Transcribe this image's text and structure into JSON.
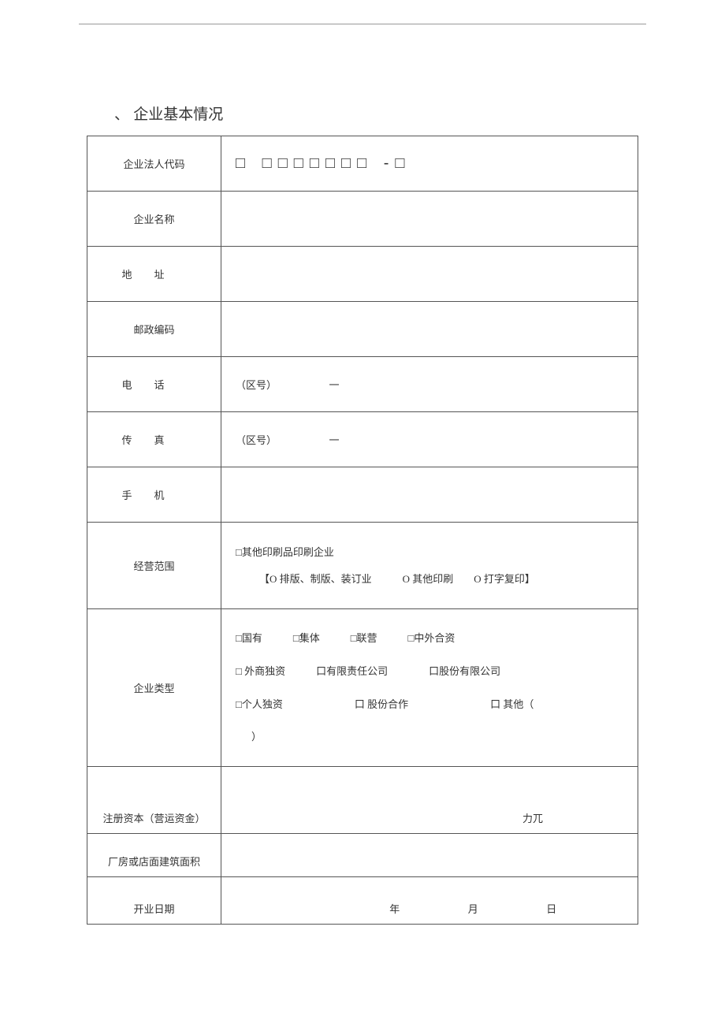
{
  "title": "、 企业基本情况",
  "rows": {
    "legal_code": {
      "label": "企业法人代码",
      "boxes": "□ □□□□□□□ -□"
    },
    "name": {
      "label": "企业名称"
    },
    "address": {
      "label_a": "地",
      "label_b": "址"
    },
    "postal": {
      "label": "邮政编码"
    },
    "phone": {
      "label_a": "电",
      "label_b": "话",
      "prefix": "（区号）",
      "dash": "一"
    },
    "fax": {
      "label_a": "传",
      "label_b": "真",
      "prefix": "（区号）",
      "dash": "一"
    },
    "mobile": {
      "label_a": "手",
      "label_b": "机"
    },
    "scope": {
      "label": "经营范围",
      "line1": "□其他印刷品印刷企业",
      "line2": "【O 排版、制版、装订业　　　O 其他印刷　　O 打字复印】"
    },
    "type": {
      "label": "企业类型",
      "opts_line1": "□国有　　　□集体　　　□联营　　　□中外合资",
      "opts_line2": "□ 外商独资　　　口有限责任公司　　　　口股份有限公司",
      "opts_line3": "□个人独资　　　　　　　口 股份合作　　　　　　　　口 其他（",
      "opts_line4": "）"
    },
    "capital": {
      "label": "注册资本（营运资金）",
      "unit": "力兀"
    },
    "area": {
      "label": "厂房或店面建筑面积"
    },
    "opened": {
      "label": "开业日期",
      "y": "年",
      "m": "月",
      "d": "日"
    }
  }
}
